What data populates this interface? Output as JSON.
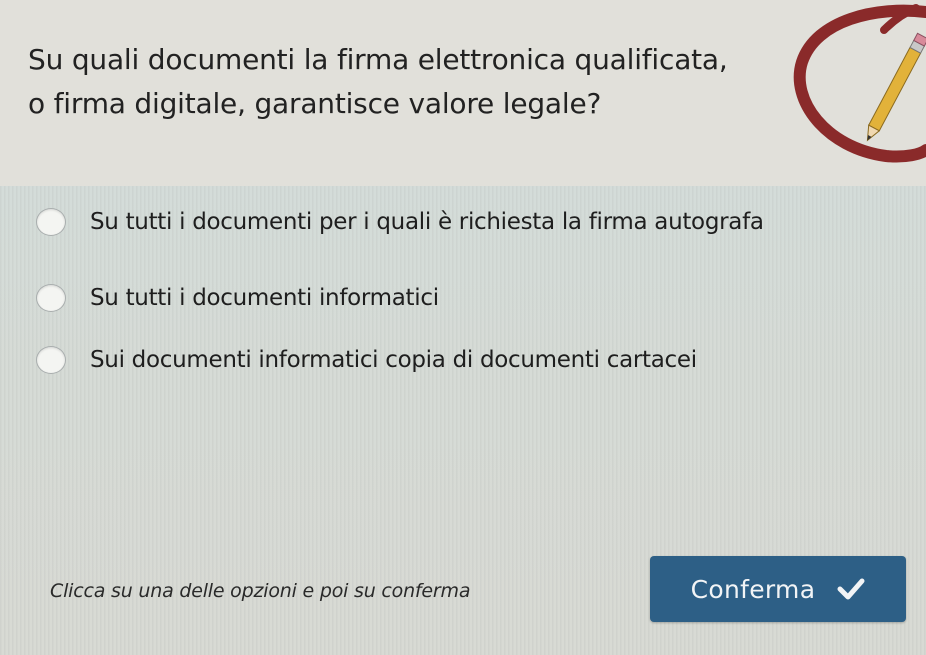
{
  "question": {
    "line1": "Su quali documenti la firma elettronica qualificata,",
    "line2": "o firma digitale, garantisce valore legale?"
  },
  "options": [
    {
      "label": "Su tutti i documenti per i quali è richiesta la firma autografa",
      "selected": false
    },
    {
      "label": "Su tutti i documenti informatici",
      "selected": false
    },
    {
      "label": "Sui documenti informatici copia di documenti cartacei",
      "selected": false
    }
  ],
  "footer": {
    "hint": "Clicca su una delle opzioni e poi su conferma",
    "confirm_label": "Conferma",
    "confirm_icon": "check-icon"
  },
  "colors": {
    "button_bg": "#2d5f86",
    "button_text": "#f2f4f6",
    "pencil_circle": "#8a2a2a",
    "pencil_body": "#e2b23a"
  }
}
